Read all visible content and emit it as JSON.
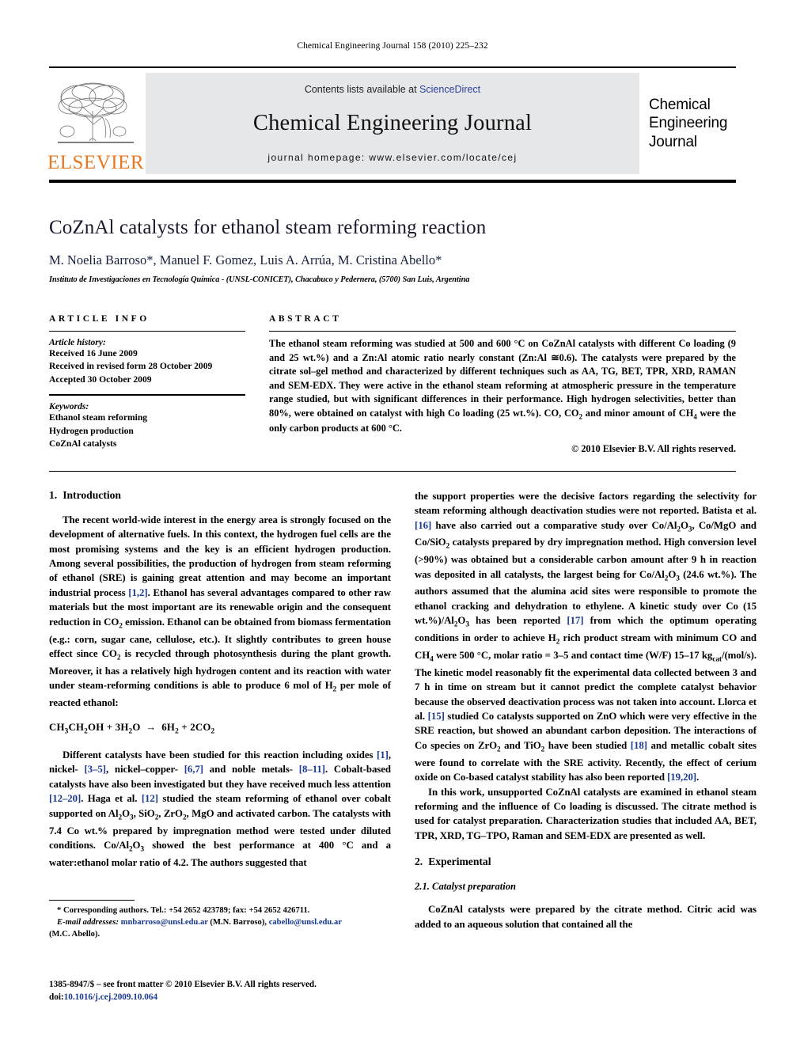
{
  "running_head": "Chemical Engineering Journal 158 (2010) 225–232",
  "masthead": {
    "contents_prefix": "Contents lists available at ",
    "sciencedirect": "ScienceDirect",
    "journal_name": "Chemical Engineering Journal",
    "homepage_label": "journal homepage: www.elsevier.com/locate/cej",
    "publisher_logo_text": "ELSEVIER",
    "publisher_logo_icon": "elsevier-tree-icon",
    "cover_lines": [
      "Chemical",
      "Engineering",
      "Journal"
    ],
    "accent_orange": "#E87722",
    "link_blue": "#2a3f9d",
    "band_gray": "#e6e7e9"
  },
  "title_block": {
    "title": "CoZnAl catalysts for ethanol steam reforming reaction",
    "authors": "M. Noelia Barroso*, Manuel F. Gomez, Luis A. Arrúa, M. Cristina Abello*",
    "affiliation": "Instituto de Investigaciones en Tecnología Química - (UNSL-CONICET), Chacabuco y Pedernera, (5700) San Luis, Argentina"
  },
  "article_info": {
    "label": "ARTICLE INFO",
    "history_head": "Article history:",
    "history": [
      "Received 16 June 2009",
      "Received in revised form 28 October 2009",
      "Accepted 30 October 2009"
    ],
    "keywords_head": "Keywords:",
    "keywords": [
      "Ethanol steam reforming",
      "Hydrogen production",
      "CoZnAl catalysts"
    ]
  },
  "abstract": {
    "label": "ABSTRACT",
    "part1": "The ethanol steam reforming was studied at 500 and 600 °C on CoZnAl catalysts with different Co loading (9 and 25 wt.%) and a Zn:Al atomic ratio nearly constant (Zn:Al ≅0.6). The catalysts were prepared by the citrate sol–gel method and characterized by different techniques such as AA, TG, BET, TPR, XRD, RAMAN and SEM-EDX. They were active in the ethanol steam reforming at atmospheric pressure in the temperature range studied, but with significant differences in their performance. High hydrogen selectivities, better than 80%, were obtained on catalyst with high Co loading (25 wt.%). CO, CO",
    "sub1": "2",
    "part2": " and minor amount of CH",
    "sub2": "4",
    "part3": " were the only carbon products at 600 °C.",
    "copyright": "© 2010 Elsevier B.V. All rights reserved."
  },
  "sections": {
    "intro_num": "1.",
    "intro_title": "Introduction",
    "experimental_num": "2.",
    "experimental_title": "Experimental",
    "cat_prep_num": "2.1.",
    "cat_prep_title": "Catalyst preparation"
  },
  "left_column": {
    "p1_a": "The recent world-wide interest in the energy area is strongly focused on the development of alternative fuels. In this context, the hydrogen fuel cells are the most promising systems and the key is an efficient hydrogen production. Among several possibilities, the production of hydrogen from steam reforming of ethanol (SRE) is gaining great attention and may become an important industrial process ",
    "p1_ref1": "[1,2]",
    "p1_b": ". Ethanol has several advantages compared to other raw materials but the most important are its renewable origin and the consequent reduction in CO",
    "p1_sub1": "2",
    "p1_c": " emission. Ethanol can be obtained from biomass fermentation (e.g.: corn, sugar cane, cellulose, etc.). It slightly contributes to green house effect since CO",
    "p1_sub2": "2",
    "p1_d": " is recycled through photosynthesis during the plant growth. Moreover, it has a relatively high hydrogen content and its reaction with water under steam-reforming conditions is able to produce 6 mol of H",
    "p1_sub3": "2",
    "p1_e": " per mole of reacted ethanol:",
    "equation": "CH3CH2OH + 3H2O → 6H2 + 2CO2",
    "p2_a": "Different catalysts have been studied for this reaction including oxides ",
    "p2_ref1": "[1]",
    "p2_b": ", nickel- ",
    "p2_ref2": "[3–5]",
    "p2_c": ", nickel–copper- ",
    "p2_ref3": "[6,7]",
    "p2_d": " and noble metals- ",
    "p2_ref4": "[8–11]",
    "p2_e": ". Cobalt-based catalysts have also been investigated but they have received much less attention ",
    "p2_ref5": "[12–20]",
    "p2_f": ". Haga et al. ",
    "p2_ref6": "[12]",
    "p2_g": " studied the steam reforming of ethanol over cobalt supported on Al",
    "p2_h": "O",
    "p2_i": ", SiO",
    "p2_j": ", ZrO",
    "p2_k": ", MgO and activated carbon. The catalysts with 7.4 Co wt.% prepared by impregnation method were tested under diluted conditions. Co/Al",
    "p2_l": "O",
    "p2_m": " showed the best performance at 400 °C and a water:ethanol molar ratio of 4.2. The authors suggested that"
  },
  "right_column": {
    "p3_a": "the support properties were the decisive factors regarding the selectivity for steam reforming although deactivation studies were not reported. Batista et al. ",
    "p3_ref1": "[16]",
    "p3_b": " have also carried out a comparative study over Co/Al",
    "p3_c": "O",
    "p3_d": ", Co/MgO and Co/SiO",
    "p3_e": " catalysts prepared by dry impregnation method. High conversion level (>90%) was obtained but a considerable carbon amount after 9 h in reaction was deposited in all catalysts, the largest being for Co/Al",
    "p3_f": "O",
    "p3_g": " (24.6 wt.%). The authors assumed that the alumina acid sites were responsible to promote the ethanol cracking and dehydration to ethylene. A kinetic study over Co (15 wt.%)/Al",
    "p3_h": "O",
    "p3_i": " has been reported ",
    "p3_ref2": "[17]",
    "p3_j": " from which the optimum operating conditions in order to achieve H",
    "p3_k": " rich product stream with minimum CO and CH",
    "p3_l": " were 500 °C, molar ratio = 3–5 and contact time (W/F) 15–17 kg",
    "p3_subcat": "cat",
    "p3_m": "/(mol/s). The kinetic model reasonably fit the experimental data collected between 3 and 7 h in time on stream but it cannot predict the complete catalyst behavior because the observed deactivation process was not taken into account. Llorca et al. ",
    "p3_ref3": "[15]",
    "p3_n": " studied Co catalysts supported on ZnO which were very effective in the SRE reaction, but showed an abundant carbon deposition. The interactions of Co species on ZrO",
    "p3_o": " and TiO",
    "p3_p": " have been studied ",
    "p3_ref4": "[18]",
    "p3_q": " and metallic cobalt sites were found to correlate with the SRE activity. Recently, the effect of cerium oxide on Co-based catalyst stability has also been reported ",
    "p3_ref5": "[19,20]",
    "p3_r": ".",
    "p4": "In this work, unsupported CoZnAl catalysts are examined in ethanol steam reforming and the influence of Co loading is discussed. The citrate method is used for catalyst preparation. Characterization studies that included AA, BET, TPR, XRD, TG–TPO, Raman and SEM-EDX are presented as well.",
    "p5": "CoZnAl catalysts were prepared by the citrate method. Citric acid was added to an aqueous solution that contained all the"
  },
  "footnotes": {
    "line1": "* Corresponding authors. Tel.: +54 2652 423789; fax: +54 2652 426711.",
    "email_label": "E-mail addresses:",
    "email1": "mnbarroso@unsl.edu.ar",
    "email1_owner": " (M.N. Barroso),",
    "email2": "cabello@unsl.edu.ar",
    "email2_owner": "(M.C. Abello).",
    "issn_line": "1385-8947/$ – see front matter © 2010 Elsevier B.V. All rights reserved.",
    "doi_label": "doi:",
    "doi_value": "10.1016/j.cej.2009.10.064"
  }
}
